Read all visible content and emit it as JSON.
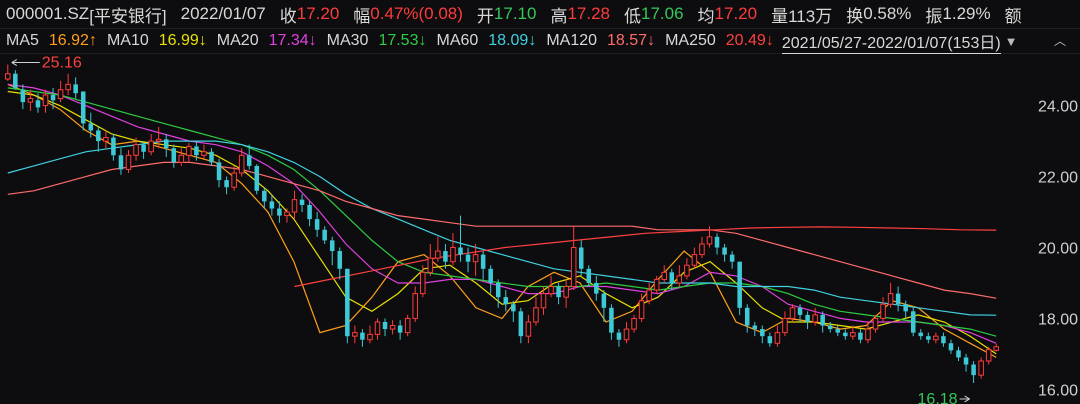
{
  "header": {
    "code": "000001.SZ",
    "name": "[平安银行]",
    "date": "2022/01/07",
    "close_label": "收",
    "close": "17.20",
    "change_label": "幅",
    "change": "0.47%(0.08)",
    "open_label": "开",
    "open": "17.10",
    "high_label": "高",
    "high": "17.28",
    "low_label": "低",
    "low": "17.06",
    "avg_label": "均",
    "avg": "17.20",
    "volume_label": "量",
    "volume": "113万",
    "turnover_label": "换",
    "turnover": "0.58%",
    "amplitude_label": "振",
    "amplitude": "1.29%",
    "amount_label": "额"
  },
  "ma_bar": {
    "items": [
      {
        "label": "MA5",
        "value": "16.92",
        "arrow": "↑",
        "color": "#ff9f1a"
      },
      {
        "label": "MA10",
        "value": "16.99",
        "arrow": "↓",
        "color": "#e8e000"
      },
      {
        "label": "MA20",
        "value": "17.34",
        "arrow": "↓",
        "color": "#e040e0"
      },
      {
        "label": "MA30",
        "value": "17.53",
        "arrow": "↓",
        "color": "#2ecc40"
      },
      {
        "label": "MA60",
        "value": "18.09",
        "arrow": "↓",
        "color": "#40d0e0"
      },
      {
        "label": "MA120",
        "value": "18.57",
        "arrow": "↓",
        "color": "#ff6b6b"
      },
      {
        "label": "MA250",
        "value": "20.49",
        "arrow": "↓",
        "color": "#ff4040"
      }
    ],
    "period": "2021/05/27-2022/01/07(153日)",
    "dropdown_icon": "triangle-down-icon",
    "collapse_icon": "chevron-up-icon"
  },
  "chart_data": {
    "type": "candlestick",
    "y_ticks": [
      "24.00",
      "22.00",
      "20.00",
      "18.00",
      "16.00"
    ],
    "ylim": [
      15.7,
      25.4
    ],
    "high_marker": "25.16",
    "low_marker": "16.18",
    "colors": {
      "up": "#ff3b3b",
      "down": "#3ec9d6",
      "axis_text": "#d0d0d0"
    },
    "candles": [
      [
        24.75,
        24.9,
        25.16,
        24.7
      ],
      [
        24.9,
        24.5,
        25.0,
        24.45
      ],
      [
        24.45,
        24.1,
        24.6,
        23.9
      ],
      [
        24.1,
        24.2,
        24.45,
        23.85
      ],
      [
        24.15,
        23.95,
        24.35,
        23.8
      ],
      [
        24.0,
        24.3,
        24.45,
        23.8
      ],
      [
        24.3,
        24.15,
        24.5,
        23.9
      ],
      [
        24.2,
        24.45,
        24.7,
        24.1
      ],
      [
        24.45,
        24.6,
        24.9,
        24.3
      ],
      [
        24.6,
        24.35,
        24.8,
        24.2
      ],
      [
        24.4,
        23.5,
        24.4,
        23.3
      ],
      [
        23.5,
        23.3,
        23.8,
        23.1
      ],
      [
        23.3,
        23.0,
        23.4,
        22.7
      ],
      [
        23.0,
        23.1,
        23.3,
        22.8
      ],
      [
        23.1,
        22.6,
        23.2,
        22.45
      ],
      [
        22.6,
        22.2,
        22.8,
        22.05
      ],
      [
        22.2,
        22.6,
        22.75,
        22.1
      ],
      [
        22.6,
        22.9,
        23.1,
        22.45
      ],
      [
        22.9,
        22.7,
        23.0,
        22.5
      ],
      [
        22.7,
        23.0,
        23.2,
        22.6
      ],
      [
        23.0,
        23.05,
        23.4,
        22.8
      ],
      [
        23.05,
        22.8,
        23.2,
        22.55
      ],
      [
        22.8,
        22.4,
        22.9,
        22.25
      ],
      [
        22.4,
        22.6,
        22.8,
        22.3
      ],
      [
        22.6,
        22.85,
        22.95,
        22.4
      ],
      [
        22.85,
        22.6,
        23.0,
        22.45
      ],
      [
        22.6,
        22.7,
        22.9,
        22.5
      ],
      [
        22.7,
        22.4,
        22.8,
        22.3
      ],
      [
        22.4,
        21.9,
        22.5,
        21.7
      ],
      [
        21.9,
        21.7,
        22.0,
        21.5
      ],
      [
        21.7,
        22.1,
        22.3,
        21.6
      ],
      [
        22.1,
        22.6,
        22.8,
        22.0
      ],
      [
        22.6,
        22.3,
        22.9,
        22.2
      ],
      [
        22.3,
        21.6,
        22.35,
        21.5
      ],
      [
        21.6,
        21.3,
        21.7,
        21.1
      ],
      [
        21.3,
        21.1,
        21.5,
        20.9
      ],
      [
        21.1,
        20.9,
        21.3,
        20.7
      ],
      [
        20.9,
        21.0,
        21.1,
        20.7
      ],
      [
        21.0,
        21.35,
        21.6,
        20.8
      ],
      [
        21.35,
        21.2,
        21.5,
        21.0
      ],
      [
        21.2,
        20.8,
        21.3,
        20.6
      ],
      [
        20.8,
        20.5,
        21.0,
        20.3
      ],
      [
        20.5,
        20.2,
        20.6,
        20.1
      ],
      [
        20.2,
        19.9,
        20.3,
        19.5
      ],
      [
        19.9,
        19.4,
        20.0,
        19.1
      ],
      [
        19.4,
        17.5,
        19.4,
        17.3
      ],
      [
        17.5,
        17.6,
        17.8,
        17.3
      ],
      [
        17.6,
        17.4,
        17.7,
        17.2
      ],
      [
        17.4,
        17.55,
        17.8,
        17.3
      ],
      [
        17.55,
        17.9,
        18.0,
        17.4
      ],
      [
        17.9,
        17.7,
        18.0,
        17.5
      ],
      [
        17.7,
        17.8,
        17.95,
        17.55
      ],
      [
        17.8,
        17.6,
        17.95,
        17.4
      ],
      [
        17.6,
        18.0,
        18.1,
        17.5
      ],
      [
        18.0,
        18.7,
        18.9,
        17.9
      ],
      [
        18.7,
        19.3,
        19.5,
        18.6
      ],
      [
        19.3,
        19.7,
        20.1,
        19.2
      ],
      [
        19.7,
        19.9,
        20.3,
        19.6
      ],
      [
        19.9,
        19.6,
        20.1,
        19.4
      ],
      [
        19.6,
        20.0,
        20.4,
        19.5
      ],
      [
        20.0,
        19.8,
        20.9,
        19.6
      ],
      [
        19.8,
        19.6,
        20.0,
        19.3
      ],
      [
        19.6,
        19.8,
        20.1,
        19.2
      ],
      [
        19.8,
        19.4,
        19.9,
        19.1
      ],
      [
        19.4,
        19.0,
        19.5,
        18.7
      ],
      [
        19.0,
        18.6,
        19.1,
        18.3
      ],
      [
        18.6,
        18.4,
        18.8,
        18.2
      ],
      [
        18.4,
        18.2,
        18.5,
        17.9
      ],
      [
        18.2,
        17.5,
        18.3,
        17.3
      ],
      [
        17.5,
        17.9,
        18.1,
        17.3
      ],
      [
        17.9,
        18.3,
        18.6,
        17.8
      ],
      [
        18.3,
        18.7,
        18.9,
        18.1
      ],
      [
        18.7,
        18.9,
        19.2,
        18.6
      ],
      [
        18.9,
        18.6,
        19.0,
        18.4
      ],
      [
        18.6,
        18.9,
        19.1,
        18.3
      ],
      [
        18.9,
        20.0,
        20.6,
        18.8
      ],
      [
        20.0,
        19.4,
        20.2,
        19.2
      ],
      [
        19.4,
        19.0,
        19.5,
        18.9
      ],
      [
        19.0,
        18.7,
        19.2,
        18.5
      ],
      [
        18.7,
        18.3,
        18.8,
        17.9
      ],
      [
        18.3,
        17.6,
        18.4,
        17.4
      ],
      [
        17.6,
        17.4,
        17.7,
        17.2
      ],
      [
        17.4,
        17.7,
        17.9,
        17.3
      ],
      [
        17.7,
        18.0,
        18.1,
        17.6
      ],
      [
        18.0,
        18.5,
        18.7,
        17.9
      ],
      [
        18.5,
        18.8,
        19.0,
        18.4
      ],
      [
        18.8,
        19.1,
        19.2,
        18.7
      ],
      [
        19.1,
        19.3,
        19.5,
        19.0
      ],
      [
        19.3,
        19.0,
        19.4,
        18.8
      ],
      [
        19.0,
        19.2,
        19.5,
        18.9
      ],
      [
        19.2,
        19.5,
        19.7,
        19.1
      ],
      [
        19.5,
        19.8,
        20.0,
        19.4
      ],
      [
        19.8,
        20.1,
        20.3,
        19.7
      ],
      [
        20.1,
        20.3,
        20.6,
        20.0
      ],
      [
        20.3,
        20.0,
        20.4,
        19.8
      ],
      [
        20.0,
        19.8,
        20.1,
        19.6
      ],
      [
        19.8,
        19.6,
        19.9,
        19.4
      ],
      [
        19.6,
        18.3,
        19.6,
        18.1
      ],
      [
        18.3,
        17.8,
        18.4,
        17.6
      ],
      [
        17.8,
        17.7,
        17.9,
        17.5
      ],
      [
        17.7,
        17.5,
        17.8,
        17.3
      ],
      [
        17.5,
        17.3,
        17.6,
        17.2
      ],
      [
        17.3,
        17.6,
        17.8,
        17.2
      ],
      [
        17.6,
        18.0,
        18.2,
        17.5
      ],
      [
        18.0,
        18.3,
        18.4,
        17.9
      ],
      [
        18.3,
        18.1,
        18.4,
        17.9
      ],
      [
        18.1,
        17.9,
        18.2,
        17.7
      ],
      [
        17.9,
        18.1,
        18.3,
        17.8
      ],
      [
        18.1,
        17.8,
        18.2,
        17.6
      ],
      [
        17.8,
        17.7,
        17.9,
        17.6
      ],
      [
        17.7,
        17.6,
        17.8,
        17.5
      ],
      [
        17.6,
        17.5,
        17.7,
        17.4
      ],
      [
        17.5,
        17.6,
        17.8,
        17.4
      ],
      [
        17.6,
        17.4,
        17.7,
        17.3
      ],
      [
        17.4,
        17.7,
        17.9,
        17.3
      ],
      [
        17.7,
        18.0,
        18.1,
        17.6
      ],
      [
        18.0,
        18.4,
        18.6,
        17.9
      ],
      [
        18.4,
        18.7,
        19.0,
        18.3
      ],
      [
        18.7,
        18.4,
        18.9,
        18.2
      ],
      [
        18.4,
        18.2,
        18.5,
        18.0
      ],
      [
        18.2,
        17.6,
        18.3,
        17.5
      ],
      [
        17.6,
        17.5,
        17.7,
        17.4
      ],
      [
        17.5,
        17.4,
        17.6,
        17.3
      ],
      [
        17.4,
        17.5,
        17.6,
        17.3
      ],
      [
        17.5,
        17.3,
        17.6,
        17.2
      ],
      [
        17.3,
        17.1,
        17.4,
        17.0
      ],
      [
        17.1,
        16.9,
        17.2,
        16.8
      ],
      [
        16.9,
        16.7,
        17.0,
        16.5
      ],
      [
        16.7,
        16.4,
        16.8,
        16.18
      ],
      [
        16.4,
        16.8,
        16.9,
        16.3
      ],
      [
        16.8,
        17.12,
        17.2,
        16.7
      ],
      [
        17.1,
        17.2,
        17.28,
        17.06
      ]
    ],
    "ma_series": [
      {
        "name": "MA5",
        "color": "#ff9f1a",
        "values": [
          24.6,
          24.3,
          23.9,
          23.3,
          22.9,
          23.0,
          22.8,
          22.6,
          22.4,
          21.8,
          21.0,
          19.6,
          17.6,
          17.8,
          18.6,
          19.6,
          19.8,
          19.2,
          18.3,
          18.0,
          18.9,
          19.3,
          19.0,
          17.9,
          18.2,
          19.1,
          19.9,
          19.3,
          17.9,
          17.6,
          18.0,
          17.9,
          17.7,
          17.8,
          18.5,
          18.3,
          17.7,
          17.3,
          16.9
        ]
      },
      {
        "name": "MA10",
        "color": "#e8e000",
        "values": [
          24.4,
          24.3,
          24.0,
          23.6,
          23.2,
          23.0,
          22.9,
          22.8,
          22.6,
          22.2,
          21.6,
          20.8,
          19.7,
          18.6,
          18.2,
          18.7,
          19.4,
          19.5,
          19.0,
          18.4,
          18.5,
          19.0,
          19.2,
          18.7,
          18.3,
          18.6,
          19.3,
          19.6,
          19.0,
          18.3,
          17.9,
          17.9,
          17.8,
          17.7,
          17.9,
          18.1,
          17.9,
          17.5,
          17.0
        ]
      },
      {
        "name": "MA20",
        "color": "#e040e0",
        "values": [
          24.6,
          24.5,
          24.3,
          24.0,
          23.7,
          23.4,
          23.2,
          23.0,
          22.9,
          22.7,
          22.3,
          21.8,
          21.0,
          20.1,
          19.4,
          19.0,
          19.0,
          19.1,
          19.1,
          18.9,
          18.7,
          18.7,
          18.9,
          18.9,
          18.8,
          18.7,
          18.9,
          19.3,
          19.2,
          18.9,
          18.4,
          18.2,
          18.0,
          17.9,
          17.9,
          17.9,
          17.8,
          17.6,
          17.3
        ]
      },
      {
        "name": "MA30",
        "color": "#2ecc40",
        "values": [
          24.5,
          24.4,
          24.3,
          24.1,
          23.9,
          23.7,
          23.5,
          23.3,
          23.1,
          22.9,
          22.6,
          22.2,
          21.6,
          20.9,
          20.2,
          19.6,
          19.3,
          19.2,
          19.1,
          19.0,
          18.9,
          18.9,
          18.9,
          19.0,
          18.9,
          18.8,
          18.9,
          19.0,
          19.0,
          18.9,
          18.7,
          18.4,
          18.2,
          18.1,
          18.0,
          17.9,
          17.8,
          17.7,
          17.5
        ]
      },
      {
        "name": "MA60",
        "color": "#40d0e0",
        "values": [
          22.1,
          22.3,
          22.5,
          22.7,
          22.8,
          22.9,
          23.0,
          23.0,
          23.0,
          22.9,
          22.7,
          22.4,
          22.0,
          21.5,
          21.1,
          20.8,
          20.5,
          20.2,
          20.0,
          19.8,
          19.6,
          19.4,
          19.3,
          19.2,
          19.1,
          19.0,
          19.0,
          19.0,
          18.9,
          18.9,
          18.9,
          18.8,
          18.6,
          18.5,
          18.4,
          18.3,
          18.2,
          18.1,
          18.09
        ]
      },
      {
        "name": "MA120",
        "color": "#ff6b6b",
        "values": [
          21.5,
          21.6,
          21.8,
          22.0,
          22.2,
          22.3,
          22.4,
          22.4,
          22.3,
          22.2,
          22.0,
          21.8,
          21.6,
          21.3,
          21.1,
          20.9,
          20.8,
          20.7,
          20.6,
          20.6,
          20.6,
          20.6,
          20.6,
          20.6,
          20.6,
          20.5,
          20.5,
          20.5,
          20.4,
          20.2,
          20.0,
          19.8,
          19.6,
          19.4,
          19.2,
          19.0,
          18.8,
          18.7,
          18.57
        ]
      },
      {
        "name": "MA250",
        "color": "#ff4040",
        "start_index": 38,
        "values": [
          18.9,
          19.1,
          19.3,
          19.5,
          19.7,
          19.85,
          20.0,
          20.1,
          20.2,
          20.3,
          20.4,
          20.45,
          20.5,
          20.55,
          20.57,
          20.58,
          20.57,
          20.55,
          20.53,
          20.5,
          20.49
        ]
      }
    ]
  }
}
